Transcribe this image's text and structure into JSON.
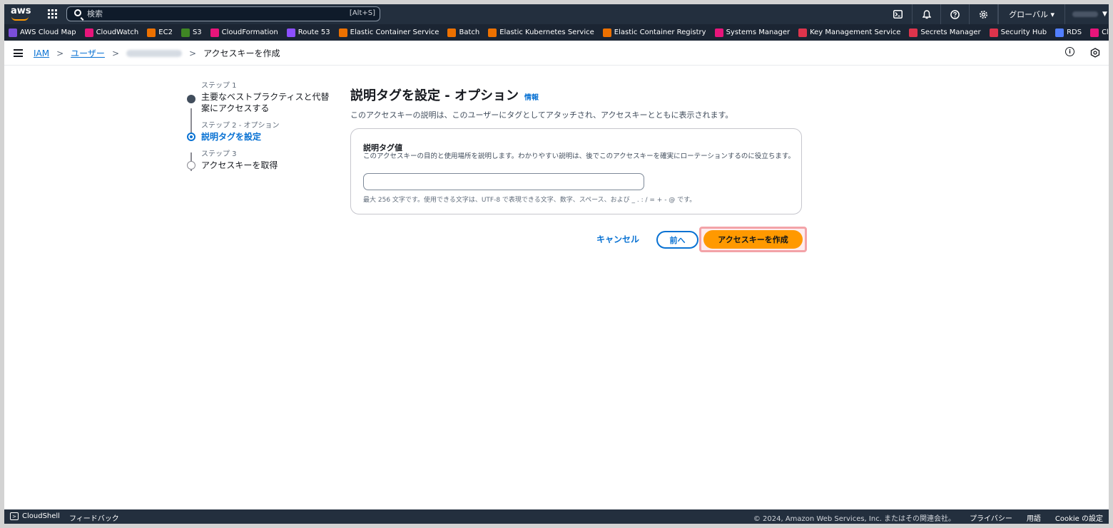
{
  "topnav": {
    "logo": "aws",
    "search_placeholder": "検索",
    "search_shortcut": "[Alt+S]",
    "region": "グローバル ▾"
  },
  "favorites": [
    {
      "label": "AWS Cloud Map",
      "color": "#7b4ed9"
    },
    {
      "label": "CloudWatch",
      "color": "#e7157b"
    },
    {
      "label": "EC2",
      "color": "#ed7100"
    },
    {
      "label": "S3",
      "color": "#3f8624"
    },
    {
      "label": "CloudFormation",
      "color": "#e7157b"
    },
    {
      "label": "Route 53",
      "color": "#8c4fff"
    },
    {
      "label": "Elastic Container Service",
      "color": "#ed7100"
    },
    {
      "label": "Batch",
      "color": "#ed7100"
    },
    {
      "label": "Elastic Kubernetes Service",
      "color": "#ed7100"
    },
    {
      "label": "Elastic Container Registry",
      "color": "#ed7100"
    },
    {
      "label": "Systems Manager",
      "color": "#e7157b"
    },
    {
      "label": "Key Management Service",
      "color": "#dd344c"
    },
    {
      "label": "Secrets Manager",
      "color": "#dd344c"
    },
    {
      "label": "Security Hub",
      "color": "#dd344c"
    },
    {
      "label": "RDS",
      "color": "#527fff"
    },
    {
      "label": "CloudTrail",
      "color": "#e7157b"
    }
  ],
  "breadcrumb": {
    "root": "IAM",
    "users": "ユーザー",
    "current": "アクセスキーを作成"
  },
  "steps": [
    {
      "label": "ステップ 1",
      "title": "主要なベストプラクティスと代替案にアクセスする",
      "state": "done"
    },
    {
      "label": "ステップ 2 - オプション",
      "title": "説明タグを設定",
      "state": "active"
    },
    {
      "label": "ステップ 3",
      "title": "アクセスキーを取得",
      "state": "pending"
    }
  ],
  "main": {
    "title": "説明タグを設定 - オプション",
    "info": "情報",
    "description": "このアクセスキーの説明は、このユーザーにタグとしてアタッチされ、アクセスキーとともに表示されます。",
    "field_label": "説明タグ値",
    "field_description": "このアクセスキーの目的と使用場所を説明します。わかりやすい説明は、後でこのアクセスキーを確実にローテーションするのに役立ちます。",
    "field_value": "",
    "field_hint": "最大 256 文字です。使用できる文字は、UTF-8 で表現できる文字、数字、スペース、および _ . : / = + - @ です。"
  },
  "actions": {
    "cancel": "キャンセル",
    "previous": "前へ",
    "create": "アクセスキーを作成"
  },
  "footer": {
    "cloudshell": "CloudShell",
    "feedback": "フィードバック",
    "copyright": "© 2024, Amazon Web Services, Inc. またはその関連会社。",
    "privacy": "プライバシー",
    "terms": "用語",
    "cookie": "Cookie の設定"
  }
}
